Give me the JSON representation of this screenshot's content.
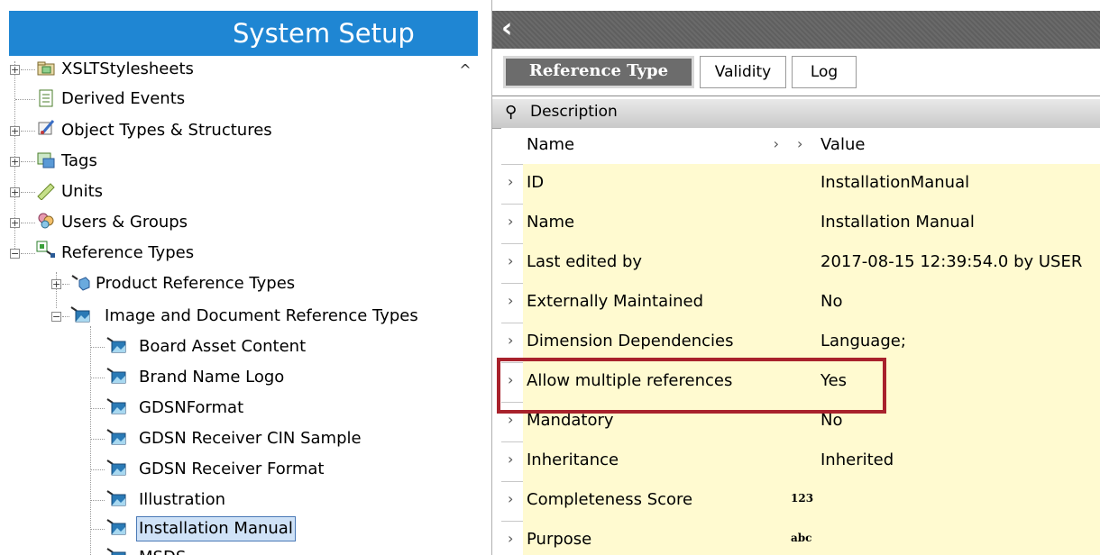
{
  "left_panel": {
    "title": "System Setup",
    "tree": [
      {
        "label": "XSLTStylesheets"
      },
      {
        "label": "Derived Events"
      },
      {
        "label": "Object Types & Structures"
      },
      {
        "label": "Tags"
      },
      {
        "label": "Units"
      },
      {
        "label": "Users & Groups"
      },
      {
        "label": "Reference Types"
      },
      {
        "label": "Product Reference Types"
      },
      {
        "label": "Image and Document Reference Types"
      },
      {
        "label": "Board Asset Content"
      },
      {
        "label": "Brand Name Logo"
      },
      {
        "label": "GDSNFormat"
      },
      {
        "label": "GDSN Receiver CIN Sample"
      },
      {
        "label": "GDSN Receiver Format"
      },
      {
        "label": "Illustration"
      },
      {
        "label": "Installation Manual"
      },
      {
        "label": "MSDS"
      }
    ]
  },
  "right_panel": {
    "tabs": [
      {
        "label": "Reference Type",
        "active": true
      },
      {
        "label": "Validity"
      },
      {
        "label": "Log"
      }
    ],
    "section": "Description",
    "columns": {
      "name": "Name",
      "value": "Value"
    },
    "rows": [
      {
        "name": "ID",
        "value": "InstallationManual"
      },
      {
        "name": "Name",
        "value": "Installation Manual"
      },
      {
        "name": "Last edited by",
        "value": "2017-08-15 12:39:54.0 by USER"
      },
      {
        "name": "Externally Maintained",
        "value": "No"
      },
      {
        "name": "Dimension Dependencies",
        "value": "Language;"
      },
      {
        "name": "Allow multiple references",
        "value": "Yes",
        "highlighted": true
      },
      {
        "name": "Mandatory",
        "value": "No"
      },
      {
        "name": "Inheritance",
        "value": "Inherited"
      },
      {
        "name": "Completeness Score",
        "value": "",
        "type_icon": "123"
      },
      {
        "name": "Purpose",
        "value": "",
        "type_icon": "abc"
      }
    ]
  },
  "colors": {
    "header_blue": "#1f86d3",
    "cell_yellow": "#fffad0",
    "highlight_red": "#a8222c",
    "selection": "#cfe2f7"
  }
}
